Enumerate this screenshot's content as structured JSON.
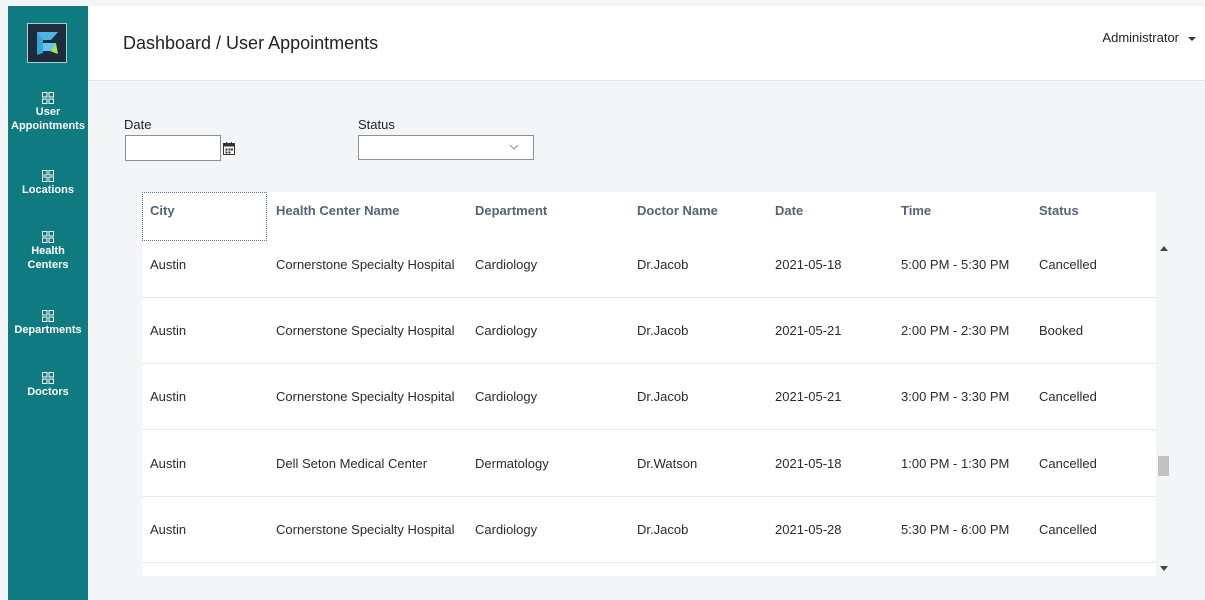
{
  "sidebar": {
    "logo": "app-logo",
    "items": [
      {
        "label": "User Appointments",
        "line1": "User",
        "line2": "Appointments",
        "icon": "grid-icon"
      },
      {
        "label": "Locations",
        "line1": "Locations",
        "line2": "",
        "icon": "grid-icon"
      },
      {
        "label": "Health Centers",
        "line1": "Health",
        "line2": "Centers",
        "icon": "grid-icon"
      },
      {
        "label": "Departments",
        "line1": "Departments",
        "line2": "",
        "icon": "grid-icon"
      },
      {
        "label": "Doctors",
        "line1": "Doctors",
        "line2": "",
        "icon": "grid-icon"
      }
    ],
    "color": "#0f7b80"
  },
  "header": {
    "breadcrumb": "Dashboard / User Appointments",
    "user": "Administrator"
  },
  "filters": {
    "date_label": "Date",
    "date_value": "",
    "status_label": "Status",
    "status_value": ""
  },
  "table": {
    "columns": [
      "City",
      "Health Center Name",
      "Department",
      "Doctor Name",
      "Date",
      "Time",
      "Status"
    ],
    "rows": [
      [
        "Austin",
        "Cornerstone Specialty Hospital",
        "Cardiology",
        "Dr.Jacob",
        "2021-05-18",
        "5:00 PM - 5:30 PM",
        "Cancelled"
      ],
      [
        "Austin",
        "Cornerstone Specialty Hospital",
        "Cardiology",
        "Dr.Jacob",
        "2021-05-21",
        "2:00 PM - 2:30 PM",
        "Booked"
      ],
      [
        "Austin",
        "Cornerstone Specialty Hospital",
        "Cardiology",
        "Dr.Jacob",
        "2021-05-21",
        "3:00 PM - 3:30 PM",
        "Cancelled"
      ],
      [
        "Austin",
        "Dell Seton Medical Center",
        "Dermatology",
        "Dr.Watson",
        "2021-05-18",
        "1:00 PM - 1:30 PM",
        "Cancelled"
      ],
      [
        "Austin",
        "Cornerstone Specialty Hospital",
        "Cardiology",
        "Dr.Jacob",
        "2021-05-28",
        "5:30 PM - 6:00 PM",
        "Cancelled"
      ]
    ]
  },
  "scroll": {
    "position": 0.66
  }
}
